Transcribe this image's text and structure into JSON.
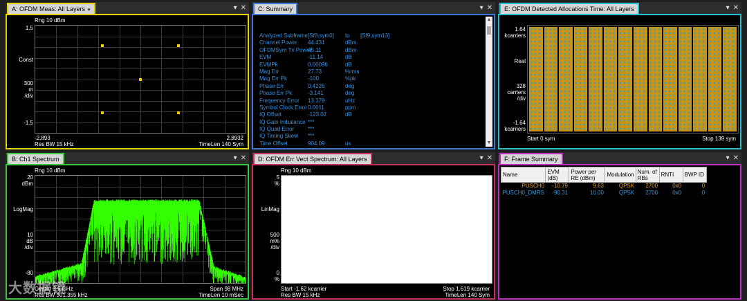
{
  "colors": {
    "A": "#e4d400",
    "B": "#3cc83c",
    "C": "#3a78d8",
    "D": "#c8305a",
    "E": "#24c0d0",
    "F": "#c030c0",
    "spectrum": "#33ff00",
    "constellation": "#f0d000",
    "summary_text": "#3b8fdc",
    "alloc": "#c89418",
    "alloc_dot": "#3aa0b8"
  },
  "windows": {
    "A": {
      "title": "A: OFDM Meas: All Layers",
      "rng": "Rng 10 dBm",
      "y_top": "1.5",
      "y_name": "Const",
      "y_scale_1": "300",
      "y_scale_2": "m",
      "y_scale_3": "/div",
      "y_bot": "-1.5",
      "x_left": "-2.893",
      "x_right": "2.8932",
      "res_bw": "Res BW 15 kHz",
      "time_len": "TimeLen 140  Sym"
    },
    "B": {
      "title": "B: Ch1 Spectrum",
      "rng": "Rng 10 dBm",
      "y_top_1": "20",
      "y_top_2": "dBm",
      "y_name": "LogMag",
      "y_scale_1": "10",
      "y_scale_2": "dB",
      "y_scale_3": "/div",
      "y_bot": "-80",
      "center": "Center 3.5 GHz",
      "res_bw": "Res BW 301.355 kHz",
      "span": "Span 98 MHz",
      "time_len": "TimeLen 10 mSec"
    },
    "C": {
      "title": "C: Summary",
      "rows": [
        {
          "k": "Analyzed  Subframe",
          "v": "[Sf0,sym0]",
          "u": "to",
          "x": "[Sf9,sym13]"
        },
        {
          "k": "Channel  Power",
          "v": "44.431",
          "u": "dBm",
          "x": ""
        },
        {
          "k": "OFDMSym  Tx  Power",
          "v": "45.11",
          "u": "dBm",
          "x": ""
        },
        {
          "k": "EVM",
          "v": "-11.14",
          "u": "dB",
          "x": ""
        },
        {
          "k": "EVMPk",
          "v": "0.00096",
          "u": "dB",
          "x": ""
        },
        {
          "k": "Mag Err",
          "v": "27.73",
          "u": "%rms",
          "x": ""
        },
        {
          "k": "Mag Err  Pk",
          "v": "-100",
          "u": "%pk",
          "x": ""
        },
        {
          "k": "Phase  Err",
          "v": "0.4226",
          "u": "deg",
          "x": ""
        },
        {
          "k": "Phase  Err  Pk",
          "v": "-3.141",
          "u": "deg",
          "x": ""
        },
        {
          "k": "Frequency  Error",
          "v": "13.179",
          "u": "uHz",
          "x": ""
        },
        {
          "k": "Symbol  Clock  Error",
          "v": "0.0011",
          "u": "ppm",
          "x": ""
        },
        {
          "k": "IQ  Offset",
          "v": "-123.02",
          "u": "dB",
          "x": ""
        },
        {
          "k": "IQ  Gain  Imbalance",
          "v": "***",
          "u": "",
          "x": ""
        },
        {
          "k": "IQ  Quad Error",
          "v": "***",
          "u": "",
          "x": ""
        },
        {
          "k": "IQ  Timing  Skew",
          "v": "***",
          "u": "",
          "x": ""
        },
        {
          "k": "Time  Offset",
          "v": "904.09",
          "u": "us",
          "x": ""
        }
      ]
    },
    "D": {
      "title": "D: OFDM Err Vect Spectrum: All Layers",
      "rng": "Rng 10 dBm",
      "y_top_1": "5",
      "y_top_2": "%",
      "y_name": "LinMag",
      "y_scale_1": "500",
      "y_scale_2": "m%",
      "y_scale_3": "/div",
      "y_bot_1": "0",
      "y_bot_2": "%",
      "start": "Start -1.62 kcarrier",
      "res_bw": "Res BW 15 kHz",
      "stop": "Stop 1.619 kcarrier",
      "time_len": "TimeLen 140  Sym"
    },
    "E": {
      "title": "E: OFDM Detected Allocations Time: All Layers",
      "y_top_1": "1.64",
      "y_top_2": "kcarriers",
      "y_name": "Real",
      "y_scale_1": "328",
      "y_scale_2": "carriers",
      "y_scale_3": "/div",
      "y_bot_1": "-1.64",
      "y_bot_2": "kcarriers",
      "start": "Start 0  sym",
      "stop": "Stop 139  sym"
    },
    "F": {
      "title": "F: Frame Summary",
      "headers": [
        "Name",
        "EVM (dB)",
        "Power per RE (dBm)",
        "Modulation",
        "Num. of RBs",
        "RNTI",
        "BWP ID"
      ],
      "rows": [
        {
          "color": "#e0a030",
          "cells": [
            "PUSCH0",
            "-10.79",
            "9.63",
            "QPSK",
            "2700",
            "0x0",
            "0"
          ]
        },
        {
          "color": "#3a9ad8",
          "cells": [
            "PUSCH0_DMRS",
            "-90.31",
            "10.00",
            "QPSK",
            "2700",
            "0x0",
            "0"
          ]
        }
      ]
    }
  },
  "constellation_points": [
    [
      -0.36,
      0.62
    ],
    [
      0.36,
      0.62
    ],
    [
      0.0,
      0.0
    ],
    [
      -0.36,
      -0.62
    ],
    [
      0.36,
      -0.62
    ]
  ],
  "icons": {
    "minimize": "▾",
    "close": "✕",
    "dropdown": "▾"
  },
  "watermark": "大数据镜"
}
